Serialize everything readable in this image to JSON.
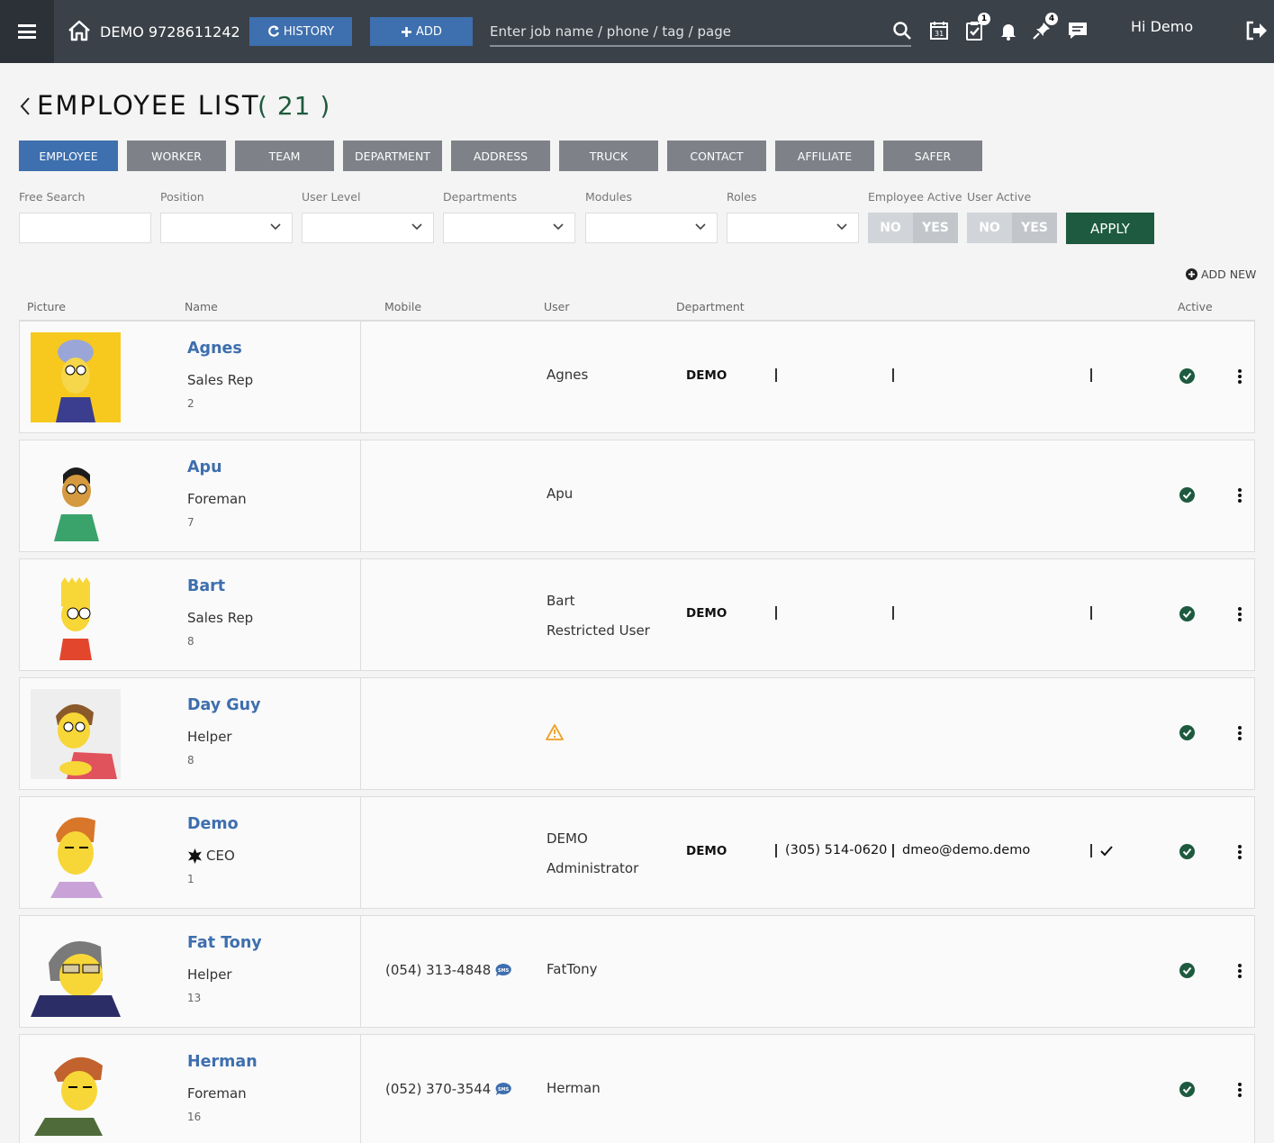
{
  "topbar": {
    "company": "DEMO 9728611242",
    "history_label": "HISTORY",
    "add_label": "ADD",
    "search_placeholder": "Enter job name / phone / tag / page",
    "tasks_badge": "1",
    "pins_badge": "4",
    "greeting": "Hi Demo"
  },
  "header": {
    "title": "EMPLOYEE LIST",
    "count": "( 21 )"
  },
  "tabs": [
    "EMPLOYEE",
    "WORKER",
    "TEAM",
    "DEPARTMENT",
    "ADDRESS",
    "TRUCK",
    "CONTACT",
    "AFFILIATE",
    "SAFER"
  ],
  "filters": {
    "free_search": "Free Search",
    "position": "Position",
    "user_level": "User Level",
    "departments": "Departments",
    "modules": "Modules",
    "roles": "Roles",
    "employee_active": "Employee Active",
    "user_active": "User Active",
    "no": "NO",
    "yes": "YES",
    "apply": "APPLY",
    "add_new": "ADD NEW"
  },
  "columns": {
    "picture": "Picture",
    "name": "Name",
    "mobile": "Mobile",
    "user": "User",
    "department": "Department",
    "active": "Active"
  },
  "colors": {
    "accent": "#3e6fae",
    "apply": "#1d5a3f",
    "active_check": "#1d5a3f",
    "topbar": "#3a4148"
  },
  "employees": [
    {
      "name": "Agnes",
      "position": "Sales Rep",
      "number": "2",
      "mobile": "",
      "user": "Agnes",
      "user_level": "",
      "department": "DEMO",
      "phone": "",
      "email": "",
      "active": true
    },
    {
      "name": "Apu",
      "position": "Foreman",
      "number": "7",
      "mobile": "",
      "user": "Apu",
      "user_level": "",
      "department": "",
      "phone": "",
      "email": "",
      "active": true
    },
    {
      "name": "Bart",
      "position": "Sales Rep",
      "number": "8",
      "mobile": "",
      "user": "Bart",
      "user_level": "Restricted User",
      "department": "DEMO",
      "phone": "",
      "email": "",
      "active": true
    },
    {
      "name": "Day Guy",
      "position": "Helper",
      "number": "8",
      "mobile": "",
      "user": "",
      "user_level": "",
      "department": "",
      "phone": "",
      "email": "",
      "active": true
    },
    {
      "name": "Demo",
      "position": "CEO",
      "number": "1",
      "mobile": "",
      "user": "DEMO",
      "user_level": "Administrator",
      "department": "DEMO",
      "phone": "(305) 514-0620",
      "email": "dmeo@demo.demo",
      "active": true
    },
    {
      "name": "Fat Tony",
      "position": "Helper",
      "number": "13",
      "mobile": "(054) 313-4848",
      "user": "FatTony",
      "user_level": "",
      "department": "",
      "phone": "",
      "email": "",
      "active": true
    },
    {
      "name": "Herman",
      "position": "Foreman",
      "number": "16",
      "mobile": "(052) 370-3544",
      "user": "Herman",
      "user_level": "",
      "department": "",
      "phone": "",
      "email": "",
      "active": true
    }
  ]
}
